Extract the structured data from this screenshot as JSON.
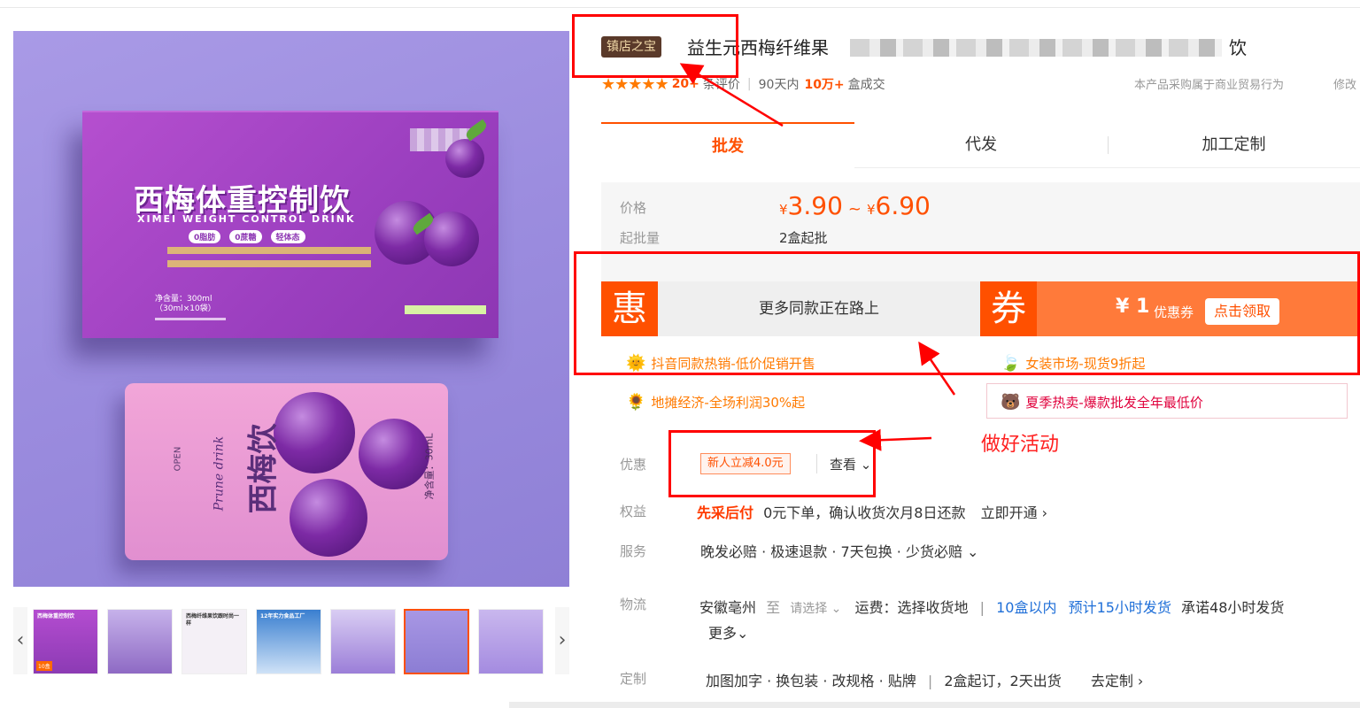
{
  "product_image": {
    "box_title": "西梅体重控制饮",
    "box_subtitle": "XIMEI WEIGHT CONTROL DRINK",
    "box_pills": [
      "0脂肪",
      "0蔗糖",
      "轻体态"
    ],
    "box_net_content": "净含量：300ml",
    "box_net_detail": "（30ml×10袋）",
    "pouch_open": "OPEN",
    "pouch_english": "Prune drink",
    "pouch_chinese": "西梅饮",
    "pouch_net": "净含量：30mL"
  },
  "thumbnails": {
    "prev_label": "‹",
    "next_label": "›",
    "items": [
      {
        "caption": "西梅体重控制饮",
        "badge": "10盒"
      },
      {
        "caption": "",
        "badge": ""
      },
      {
        "caption": "西梅纤维果饮跟时尚一样",
        "badge": ""
      },
      {
        "caption": "12年实力食品工厂",
        "badge": ""
      },
      {
        "caption": "",
        "badge": ""
      },
      {
        "caption": "",
        "badge": ""
      },
      {
        "caption": "",
        "badge": ""
      }
    ]
  },
  "header": {
    "badge": "镇店之宝",
    "title": "益生元西梅纤维果",
    "title_tail": "饮",
    "rating_count": "20+",
    "rating_word": "条评价",
    "sales_prefix": "90天内",
    "sales_count": "10万+",
    "sales_unit": "盒成交",
    "commercial_note": "本产品采购属于商业贸易行为",
    "modify_link": "修改"
  },
  "tabs": [
    "批发",
    "代发",
    "加工定制"
  ],
  "pricing": {
    "price_label": "价格",
    "currency": "¥",
    "low": "3.90",
    "high": "6.90",
    "moq_label": "起批量",
    "moq": "2盒起批"
  },
  "promo_banner": {
    "hui_char": "惠",
    "hui_text": "更多同款正在路上",
    "quan_char": "券",
    "coupon_amount": "¥ 1",
    "coupon_word": "优惠券",
    "coupon_button": "点击领取"
  },
  "promos": [
    {
      "icon": "sun-icon",
      "glyph": "🌞",
      "text": "抖音同款热销-低价促销开售"
    },
    {
      "icon": "leaf-icon",
      "glyph": "🍃",
      "text": "女装市场-现货9折起"
    },
    {
      "icon": "flower-icon",
      "glyph": "🌻",
      "text": "地摊经济-全场利润30%起"
    },
    {
      "icon": "bear-icon",
      "glyph": "🐻",
      "text": "夏季热卖-爆款批发全年最低价"
    }
  ],
  "discount": {
    "label": "优惠",
    "tag": "新人立减4.0元",
    "view": "查看 ⌄"
  },
  "rights": {
    "label": "权益",
    "highlight": "先采后付",
    "text": "0元下单，确认收货次月8日还款",
    "action": "立即开通 ›"
  },
  "service": {
    "label": "服务",
    "text": "晚发必赔 · 极速退款 · 7天包换 · 少货必赔 ⌄"
  },
  "logistics": {
    "label": "物流",
    "origin": "安徽亳州",
    "to": "至",
    "select": "请选择 ⌄",
    "fee": "运费：选择收货地",
    "qty": "10盒以内",
    "estimate": "预计15小时发货",
    "promise": "承诺48小时发货",
    "more": "更多⌄"
  },
  "custom": {
    "label": "定制",
    "options": "加图加字 · 换包装 · 改规格 · 贴牌",
    "terms": "2盒起订，2天出货",
    "action": "去定制 ›"
  },
  "annotation": {
    "text": "做好活动",
    "color": "#ff0000"
  },
  "colors": {
    "accent": "#ff5000",
    "annotation_red": "#ff0000",
    "badge_bg": "#5a3a2a",
    "badge_text": "#f1d9a8",
    "link_blue": "#1f6fd8"
  }
}
